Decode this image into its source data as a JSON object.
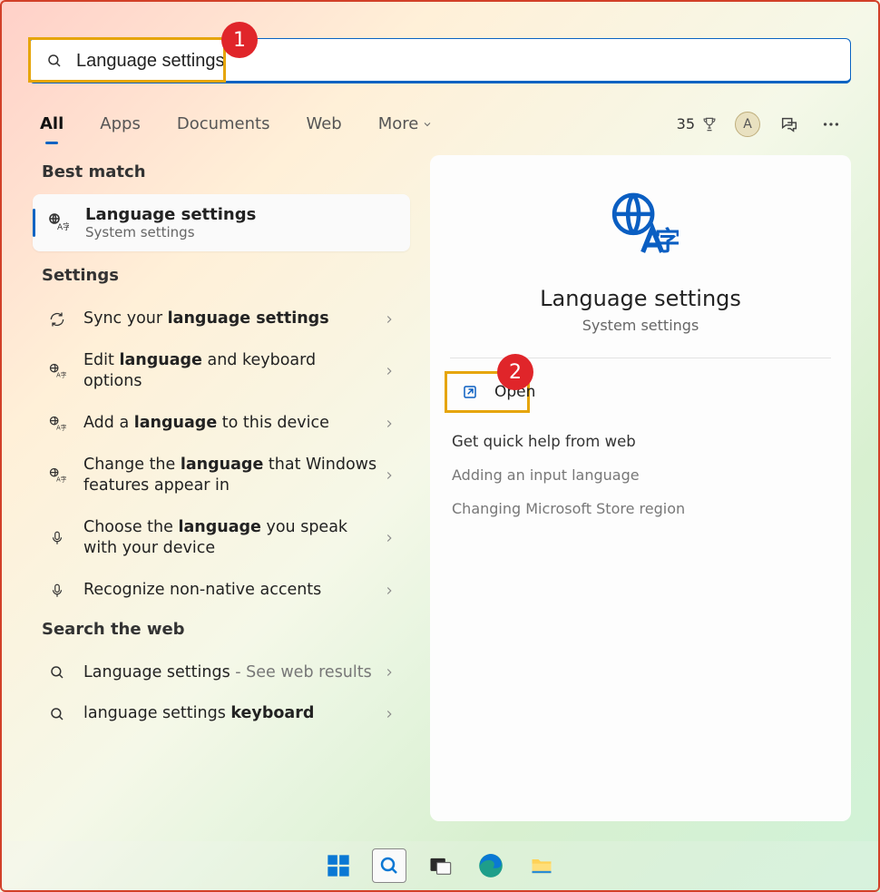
{
  "search": {
    "value": "Language settings"
  },
  "tabs": {
    "all": "All",
    "apps": "Apps",
    "documents": "Documents",
    "web": "Web",
    "more": "More"
  },
  "header": {
    "points": "35",
    "avatar_letter": "A"
  },
  "sections": {
    "best": "Best match",
    "settings": "Settings",
    "web": "Search the web"
  },
  "best": {
    "title": "Language settings",
    "sub": "System settings"
  },
  "settings_items": {
    "sync": {
      "pre": "Sync your ",
      "hl": "language settings"
    },
    "edit": {
      "pre": "Edit ",
      "hl": "language",
      "post": " and keyboard options"
    },
    "add": {
      "pre": "Add a ",
      "hl": "language",
      "post": " to this device"
    },
    "change": {
      "pre": "Change the ",
      "hl": "language",
      "post": " that Windows features appear in"
    },
    "choose": {
      "pre": "Choose the ",
      "hl": "language",
      "post": " you speak with your device"
    },
    "accent": {
      "pre": "Recognize non-native accents"
    }
  },
  "web_items": {
    "r1": {
      "pre": "Language settings",
      "post": " - See web results"
    },
    "r2": {
      "pre": "language settings ",
      "hl": "keyboard"
    }
  },
  "preview": {
    "title": "Language settings",
    "sub": "System settings",
    "open": "Open",
    "help_title": "Get quick help from web",
    "help1": "Adding an input language",
    "help2": "Changing Microsoft Store region"
  },
  "annotations": {
    "one": "1",
    "two": "2"
  }
}
